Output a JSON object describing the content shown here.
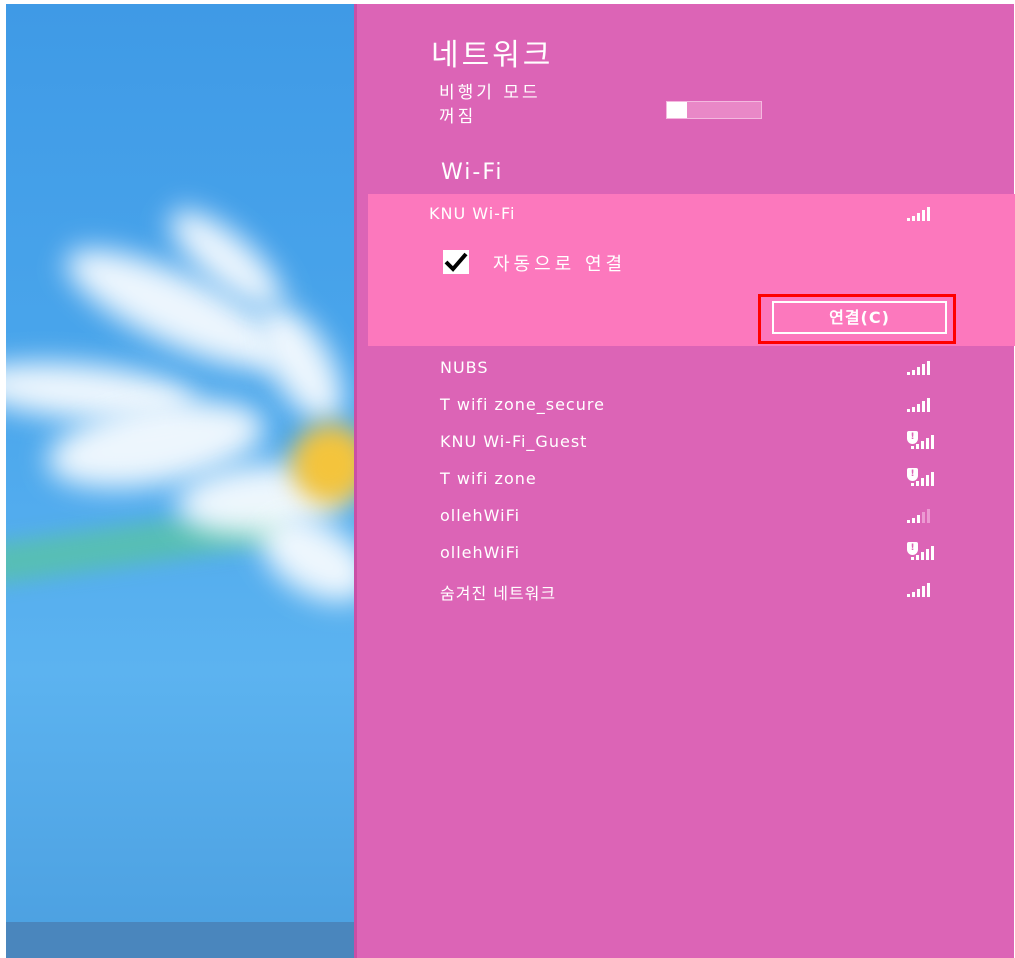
{
  "panel": {
    "title": "네트워크",
    "airplane_mode": {
      "label": "비행기 모드",
      "state": "꺼짐"
    },
    "wifi_heading": "Wi-Fi"
  },
  "selected_network": {
    "name": "KNU Wi-Fi",
    "signal_icon": "signal-full-icon",
    "auto_connect_label": "자동으로 연결",
    "auto_connect_checked": true,
    "connect_label": "연결(C)",
    "highlight_color": "#ff0000"
  },
  "networks": [
    {
      "name": "NUBS",
      "secured": true,
      "signal": "full"
    },
    {
      "name": "T wifi zone_secure",
      "secured": true,
      "signal": "full"
    },
    {
      "name": "KNU Wi-Fi_Guest",
      "secured": false,
      "signal": "full"
    },
    {
      "name": "T wifi zone",
      "secured": false,
      "signal": "full"
    },
    {
      "name": "ollehWiFi",
      "secured": true,
      "signal": "weak"
    },
    {
      "name": "ollehWiFi",
      "secured": false,
      "signal": "full"
    },
    {
      "name": "숨겨진 네트워크",
      "secured": true,
      "signal": "full"
    }
  ],
  "colors": {
    "panel_bg": "#dc64b6",
    "selected_bg": "#fc78bd",
    "desktop_bg": "#4aa6ec"
  }
}
